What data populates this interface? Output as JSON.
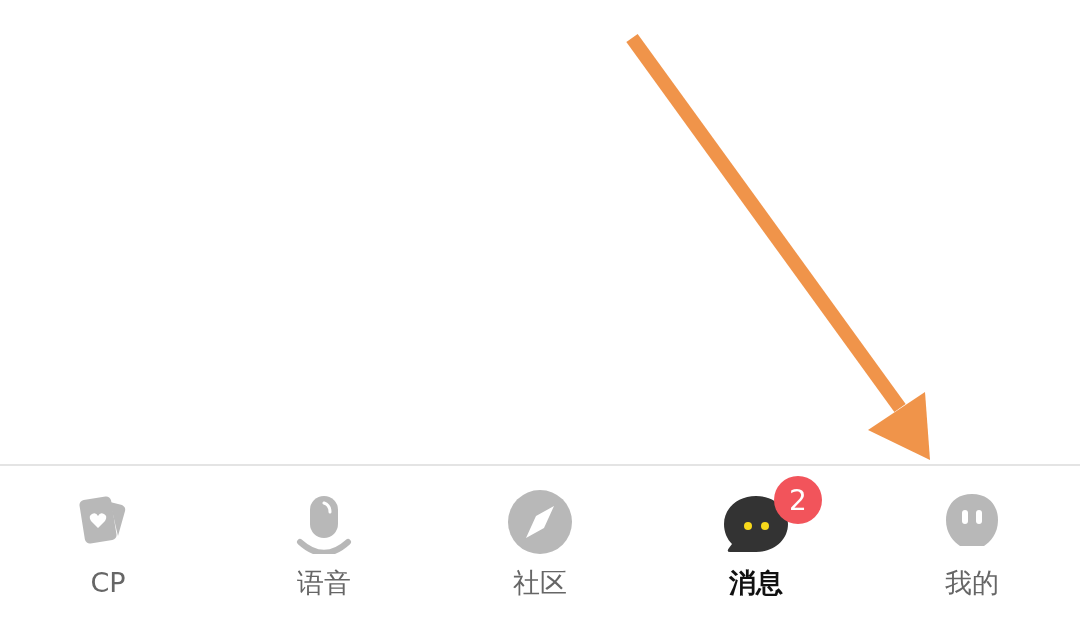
{
  "tabs": [
    {
      "label": "CP",
      "kind": "cards",
      "selected": false
    },
    {
      "label": "语音",
      "kind": "mic",
      "selected": false
    },
    {
      "label": "社区",
      "kind": "compass",
      "selected": false
    },
    {
      "label": "消息",
      "kind": "chat",
      "selected": true,
      "badge": "2"
    },
    {
      "label": "我的",
      "kind": "ghost",
      "selected": false
    }
  ]
}
